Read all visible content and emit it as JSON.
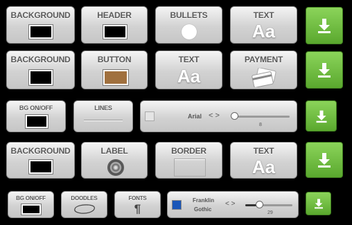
{
  "row1": {
    "background": "BACKGROUND",
    "header": "HEADER",
    "bullets": "BULLETS",
    "text": "TEXT",
    "aa": "Aa"
  },
  "row2": {
    "background": "BACKGROUND",
    "button": "BUTTON",
    "text": "TEXT",
    "payment": "PAYMENT",
    "aa": "Aa",
    "button_color": "#a0703e"
  },
  "row3": {
    "bg_toggle": "BG ON/OFF",
    "lines": "LINES",
    "font_name": "Arial",
    "arrows": "< >",
    "size": "8",
    "size_fraction": 0.05
  },
  "row4": {
    "background": "BACKGROUND",
    "label": "LABEL",
    "border": "BORDER",
    "text": "TEXT",
    "aa": "Aa"
  },
  "row5": {
    "bg_toggle": "BG ON/OFF",
    "doodles": "DOODLES",
    "fonts": "FONTS",
    "font_glyph": "¶",
    "font_name_1": "Franklin",
    "font_name_2": "Gothic",
    "arrows": "< >",
    "size": "29",
    "size_fraction": 0.3,
    "swatch_color": "#1a56b8"
  },
  "colors": {
    "accent_green": "#6cc03d",
    "tile": "#d8d8d8",
    "label": "#5a5a5a"
  },
  "icons": {
    "apply": "download-icon"
  }
}
